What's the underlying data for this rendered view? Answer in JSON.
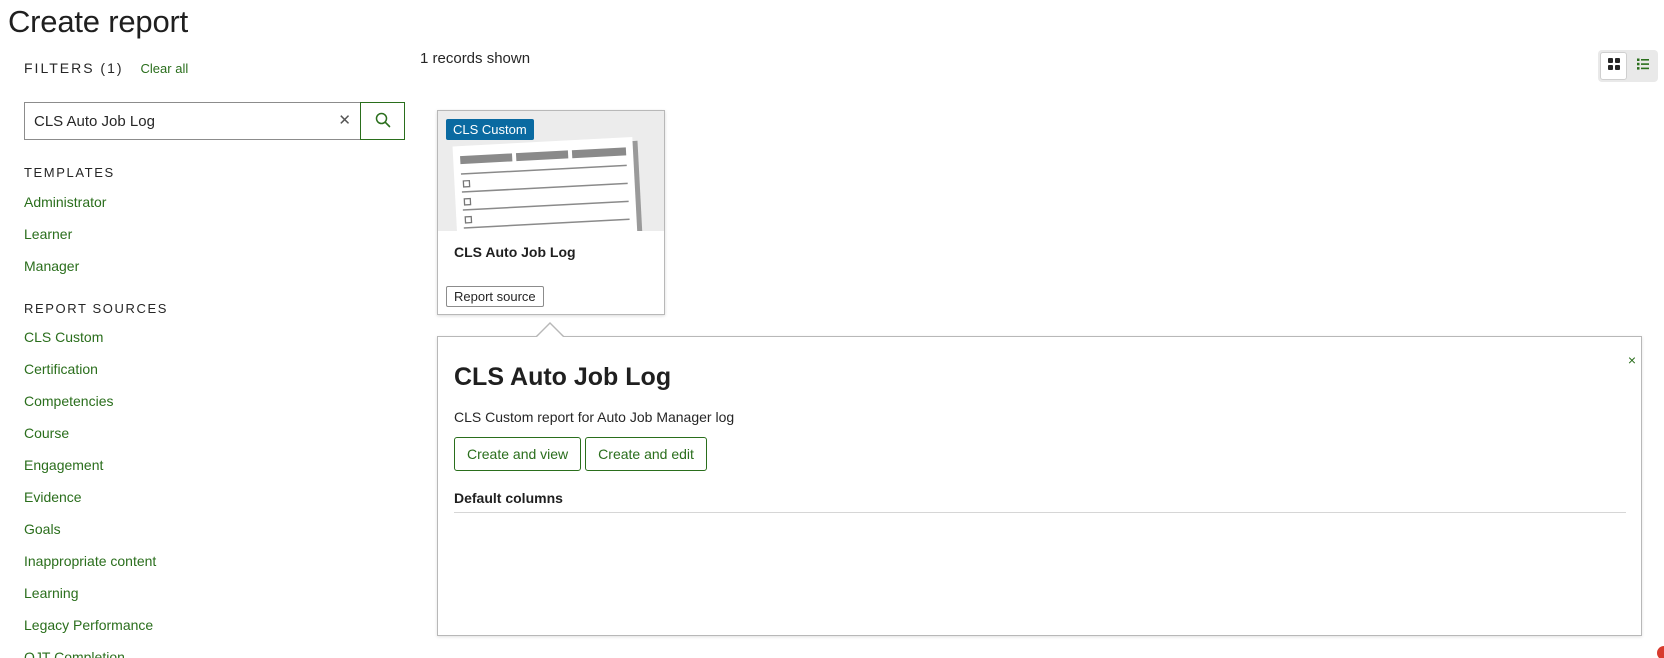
{
  "page": {
    "title": "Create report"
  },
  "filters": {
    "title": "FILTERS (1)",
    "clear_all": "Clear all",
    "search": {
      "value": "CLS Auto Job Log",
      "placeholder": "Search"
    }
  },
  "templates": {
    "title": "TEMPLATES",
    "items": [
      "Administrator",
      "Learner",
      "Manager"
    ]
  },
  "report_sources": {
    "title": "REPORT SOURCES",
    "items": [
      "CLS Custom",
      "Certification",
      "Competencies",
      "Course",
      "Engagement",
      "Evidence",
      "Goals",
      "Inappropriate content",
      "Learning",
      "Legacy Performance",
      "OJT Completion"
    ]
  },
  "results": {
    "count_text": "1 records shown"
  },
  "card": {
    "badge": "CLS Custom",
    "name": "CLS Auto Job Log",
    "source_button": "Report source"
  },
  "detail": {
    "close": "×",
    "title": "CLS Auto Job Log",
    "description": "CLS Custom report for Auto Job Manager log",
    "buttons": {
      "create_view": "Create and view",
      "create_edit": "Create and edit"
    },
    "default_columns": "Default columns"
  },
  "icons": {
    "search": "search-icon",
    "clear": "clear-x-icon",
    "grid": "grid-view-icon",
    "list": "list-view-icon"
  },
  "colors": {
    "link_green": "#2a6e1c",
    "badge_blue": "#0a6aa1"
  }
}
